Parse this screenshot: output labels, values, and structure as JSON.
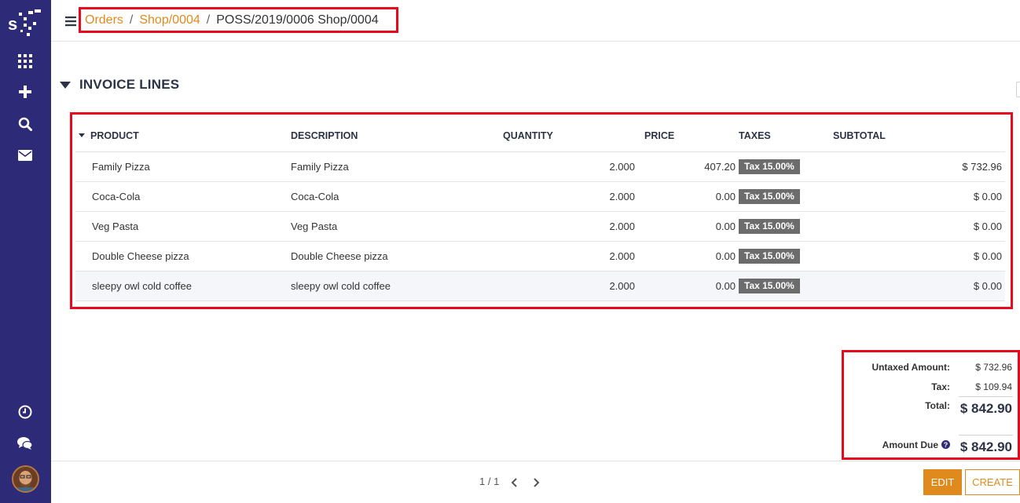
{
  "sidebar": {
    "icons": [
      "apps-icon",
      "plus-icon",
      "search-icon",
      "mail-icon",
      "clock-icon",
      "chat-icon"
    ]
  },
  "breadcrumb": {
    "items": [
      {
        "label": "Orders"
      },
      {
        "label": "Shop/0004"
      }
    ],
    "separator": "/",
    "current": "POSS/2019/0006 Shop/0004"
  },
  "section": {
    "title": "INVOICE LINES"
  },
  "table": {
    "headers": {
      "product": "PRODUCT",
      "description": "DESCRIPTION",
      "quantity": "QUANTITY",
      "price": "PRICE",
      "taxes": "TAXES",
      "subtotal": "SUBTOTAL"
    },
    "rows": [
      {
        "product": "Family Pizza",
        "description": "Family Pizza",
        "quantity": "2.000",
        "price": "407.20",
        "tax": "Tax 15.00%",
        "subtotal": "$ 732.96"
      },
      {
        "product": "Coca-Cola",
        "description": "Coca-Cola",
        "quantity": "2.000",
        "price": "0.00",
        "tax": "Tax 15.00%",
        "subtotal": "$ 0.00"
      },
      {
        "product": "Veg Pasta",
        "description": "Veg Pasta",
        "quantity": "2.000",
        "price": "0.00",
        "tax": "Tax 15.00%",
        "subtotal": "$ 0.00"
      },
      {
        "product": "Double Cheese pizza",
        "description": "Double Cheese pizza",
        "quantity": "2.000",
        "price": "0.00",
        "tax": "Tax 15.00%",
        "subtotal": "$ 0.00"
      },
      {
        "product": "sleepy owl cold coffee",
        "description": "sleepy owl cold coffee",
        "quantity": "2.000",
        "price": "0.00",
        "tax": "Tax 15.00%",
        "subtotal": "$ 0.00"
      }
    ]
  },
  "totals": {
    "untaxed_label": "Untaxed Amount:",
    "untaxed_value": "$ 732.96",
    "tax_label": "Tax:",
    "tax_value": "$ 109.94",
    "total_label": "Total:",
    "total_value": "$ 842.90",
    "amount_due_label": "Amount Due",
    "amount_due_value": "$ 842.90"
  },
  "footer": {
    "pager": "1 / 1",
    "edit_label": "EDIT",
    "create_label": "CREATE"
  },
  "colors": {
    "sidebar": "#2d2a78",
    "accent": "#e08a1e",
    "highlight_border": "#e8091d",
    "tax_badge": "#6c6c6c"
  }
}
